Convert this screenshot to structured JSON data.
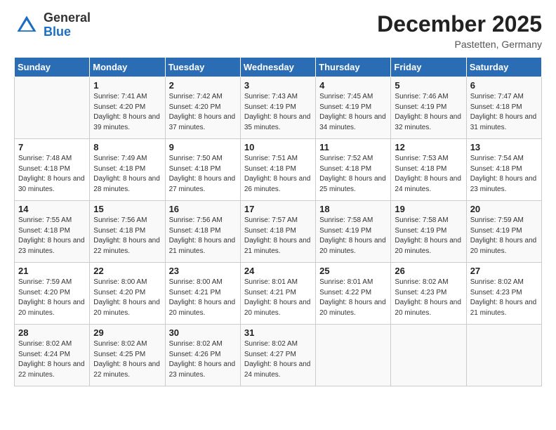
{
  "header": {
    "logo": {
      "general": "General",
      "blue": "Blue"
    },
    "month_year": "December 2025",
    "location": "Pastetten, Germany"
  },
  "weekdays": [
    "Sunday",
    "Monday",
    "Tuesday",
    "Wednesday",
    "Thursday",
    "Friday",
    "Saturday"
  ],
  "weeks": [
    [
      {
        "day": "",
        "sunrise": "",
        "sunset": "",
        "daylight": ""
      },
      {
        "day": "1",
        "sunrise": "Sunrise: 7:41 AM",
        "sunset": "Sunset: 4:20 PM",
        "daylight": "Daylight: 8 hours and 39 minutes."
      },
      {
        "day": "2",
        "sunrise": "Sunrise: 7:42 AM",
        "sunset": "Sunset: 4:20 PM",
        "daylight": "Daylight: 8 hours and 37 minutes."
      },
      {
        "day": "3",
        "sunrise": "Sunrise: 7:43 AM",
        "sunset": "Sunset: 4:19 PM",
        "daylight": "Daylight: 8 hours and 35 minutes."
      },
      {
        "day": "4",
        "sunrise": "Sunrise: 7:45 AM",
        "sunset": "Sunset: 4:19 PM",
        "daylight": "Daylight: 8 hours and 34 minutes."
      },
      {
        "day": "5",
        "sunrise": "Sunrise: 7:46 AM",
        "sunset": "Sunset: 4:19 PM",
        "daylight": "Daylight: 8 hours and 32 minutes."
      },
      {
        "day": "6",
        "sunrise": "Sunrise: 7:47 AM",
        "sunset": "Sunset: 4:18 PM",
        "daylight": "Daylight: 8 hours and 31 minutes."
      }
    ],
    [
      {
        "day": "7",
        "sunrise": "Sunrise: 7:48 AM",
        "sunset": "Sunset: 4:18 PM",
        "daylight": "Daylight: 8 hours and 30 minutes."
      },
      {
        "day": "8",
        "sunrise": "Sunrise: 7:49 AM",
        "sunset": "Sunset: 4:18 PM",
        "daylight": "Daylight: 8 hours and 28 minutes."
      },
      {
        "day": "9",
        "sunrise": "Sunrise: 7:50 AM",
        "sunset": "Sunset: 4:18 PM",
        "daylight": "Daylight: 8 hours and 27 minutes."
      },
      {
        "day": "10",
        "sunrise": "Sunrise: 7:51 AM",
        "sunset": "Sunset: 4:18 PM",
        "daylight": "Daylight: 8 hours and 26 minutes."
      },
      {
        "day": "11",
        "sunrise": "Sunrise: 7:52 AM",
        "sunset": "Sunset: 4:18 PM",
        "daylight": "Daylight: 8 hours and 25 minutes."
      },
      {
        "day": "12",
        "sunrise": "Sunrise: 7:53 AM",
        "sunset": "Sunset: 4:18 PM",
        "daylight": "Daylight: 8 hours and 24 minutes."
      },
      {
        "day": "13",
        "sunrise": "Sunrise: 7:54 AM",
        "sunset": "Sunset: 4:18 PM",
        "daylight": "Daylight: 8 hours and 23 minutes."
      }
    ],
    [
      {
        "day": "14",
        "sunrise": "Sunrise: 7:55 AM",
        "sunset": "Sunset: 4:18 PM",
        "daylight": "Daylight: 8 hours and 23 minutes."
      },
      {
        "day": "15",
        "sunrise": "Sunrise: 7:56 AM",
        "sunset": "Sunset: 4:18 PM",
        "daylight": "Daylight: 8 hours and 22 minutes."
      },
      {
        "day": "16",
        "sunrise": "Sunrise: 7:56 AM",
        "sunset": "Sunset: 4:18 PM",
        "daylight": "Daylight: 8 hours and 21 minutes."
      },
      {
        "day": "17",
        "sunrise": "Sunrise: 7:57 AM",
        "sunset": "Sunset: 4:18 PM",
        "daylight": "Daylight: 8 hours and 21 minutes."
      },
      {
        "day": "18",
        "sunrise": "Sunrise: 7:58 AM",
        "sunset": "Sunset: 4:19 PM",
        "daylight": "Daylight: 8 hours and 20 minutes."
      },
      {
        "day": "19",
        "sunrise": "Sunrise: 7:58 AM",
        "sunset": "Sunset: 4:19 PM",
        "daylight": "Daylight: 8 hours and 20 minutes."
      },
      {
        "day": "20",
        "sunrise": "Sunrise: 7:59 AM",
        "sunset": "Sunset: 4:19 PM",
        "daylight": "Daylight: 8 hours and 20 minutes."
      }
    ],
    [
      {
        "day": "21",
        "sunrise": "Sunrise: 7:59 AM",
        "sunset": "Sunset: 4:20 PM",
        "daylight": "Daylight: 8 hours and 20 minutes."
      },
      {
        "day": "22",
        "sunrise": "Sunrise: 8:00 AM",
        "sunset": "Sunset: 4:20 PM",
        "daylight": "Daylight: 8 hours and 20 minutes."
      },
      {
        "day": "23",
        "sunrise": "Sunrise: 8:00 AM",
        "sunset": "Sunset: 4:21 PM",
        "daylight": "Daylight: 8 hours and 20 minutes."
      },
      {
        "day": "24",
        "sunrise": "Sunrise: 8:01 AM",
        "sunset": "Sunset: 4:21 PM",
        "daylight": "Daylight: 8 hours and 20 minutes."
      },
      {
        "day": "25",
        "sunrise": "Sunrise: 8:01 AM",
        "sunset": "Sunset: 4:22 PM",
        "daylight": "Daylight: 8 hours and 20 minutes."
      },
      {
        "day": "26",
        "sunrise": "Sunrise: 8:02 AM",
        "sunset": "Sunset: 4:23 PM",
        "daylight": "Daylight: 8 hours and 20 minutes."
      },
      {
        "day": "27",
        "sunrise": "Sunrise: 8:02 AM",
        "sunset": "Sunset: 4:23 PM",
        "daylight": "Daylight: 8 hours and 21 minutes."
      }
    ],
    [
      {
        "day": "28",
        "sunrise": "Sunrise: 8:02 AM",
        "sunset": "Sunset: 4:24 PM",
        "daylight": "Daylight: 8 hours and 22 minutes."
      },
      {
        "day": "29",
        "sunrise": "Sunrise: 8:02 AM",
        "sunset": "Sunset: 4:25 PM",
        "daylight": "Daylight: 8 hours and 22 minutes."
      },
      {
        "day": "30",
        "sunrise": "Sunrise: 8:02 AM",
        "sunset": "Sunset: 4:26 PM",
        "daylight": "Daylight: 8 hours and 23 minutes."
      },
      {
        "day": "31",
        "sunrise": "Sunrise: 8:02 AM",
        "sunset": "Sunset: 4:27 PM",
        "daylight": "Daylight: 8 hours and 24 minutes."
      },
      {
        "day": "",
        "sunrise": "",
        "sunset": "",
        "daylight": ""
      },
      {
        "day": "",
        "sunrise": "",
        "sunset": "",
        "daylight": ""
      },
      {
        "day": "",
        "sunrise": "",
        "sunset": "",
        "daylight": ""
      }
    ]
  ]
}
